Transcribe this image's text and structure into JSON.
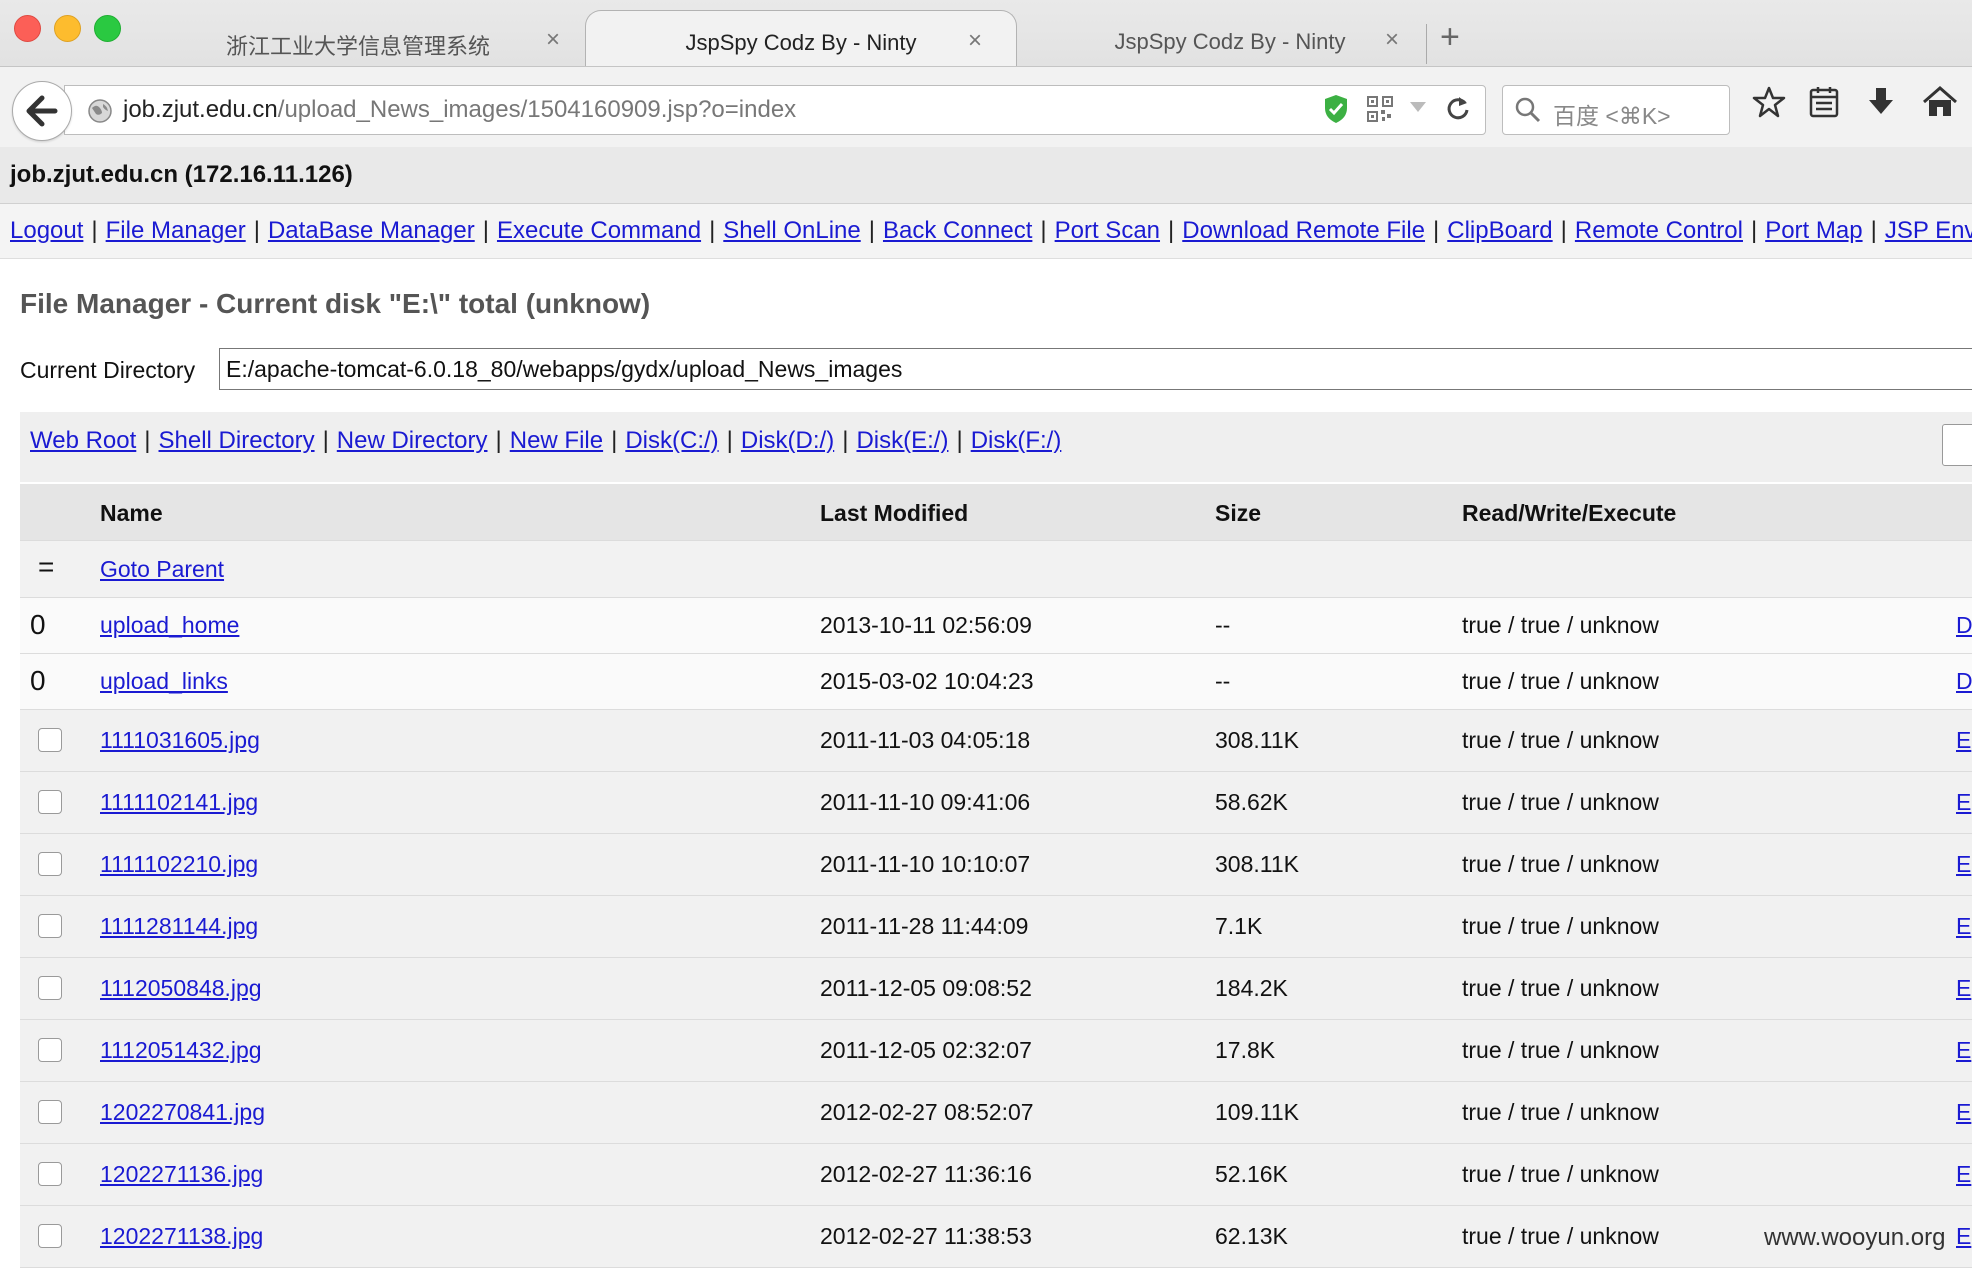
{
  "browser": {
    "tabs": [
      {
        "label": "浙江工业大学信息管理系统",
        "active": false
      },
      {
        "label": "JspSpy Codz By - Ninty",
        "active": true
      },
      {
        "label": "JspSpy Codz By - Ninty",
        "active": false
      }
    ],
    "tab_close_glyph": "×",
    "new_tab_glyph": "+",
    "url_host": "job.zjut.edu.cn",
    "url_path": "/upload_News_images/1504160909.jsp?o=index",
    "search_placeholder": "百度 <⌘K>"
  },
  "page": {
    "host_title": "job.zjut.edu.cn (172.16.11.126)",
    "menu": [
      "Logout",
      "File Manager",
      "DataBase Manager",
      "Execute Command",
      "Shell OnLine",
      "Back Connect",
      "Port Scan",
      "Download Remote File",
      "ClipBoard",
      "Remote Control",
      "Port Map",
      "JSP Env"
    ],
    "fm_title": "File Manager - Current disk \"E:\\\" total (unknow)",
    "current_dir_label": "Current Directory",
    "current_dir_value": "E:/apache-tomcat-6.0.18_80/webapps/gydx/upload_News_images",
    "quick_links": [
      "Web Root",
      "Shell Directory",
      "New Directory",
      "New File",
      "Disk(C:/)",
      "Disk(D:/)",
      "Disk(E:/)",
      "Disk(F:/)"
    ],
    "table": {
      "headers": {
        "name": "Name",
        "modified": "Last Modified",
        "size": "Size",
        "rwx": "Read/Write/Execute"
      },
      "parent": {
        "marker": "=",
        "label": "Goto Parent"
      },
      "dirs": [
        {
          "marker": "0",
          "name": "upload_home",
          "modified": "2013-10-11 02:56:09",
          "size": "--",
          "rwx": "true / true / unknow",
          "action": "D"
        },
        {
          "marker": "0",
          "name": "upload_links",
          "modified": "2015-03-02 10:04:23",
          "size": "--",
          "rwx": "true / true / unknow",
          "action": "D"
        }
      ],
      "files": [
        {
          "name": "1111031605.jpg",
          "modified": "2011-11-03 04:05:18",
          "size": "308.11K",
          "rwx": "true / true / unknow",
          "action": "E"
        },
        {
          "name": "1111102141.jpg",
          "modified": "2011-11-10 09:41:06",
          "size": "58.62K",
          "rwx": "true / true / unknow",
          "action": "E"
        },
        {
          "name": "1111102210.jpg",
          "modified": "2011-11-10 10:10:07",
          "size": "308.11K",
          "rwx": "true / true / unknow",
          "action": "E"
        },
        {
          "name": "1111281144.jpg",
          "modified": "2011-11-28 11:44:09",
          "size": "7.1K",
          "rwx": "true / true / unknow",
          "action": "E"
        },
        {
          "name": "1112050848.jpg",
          "modified": "2011-12-05 09:08:52",
          "size": "184.2K",
          "rwx": "true / true / unknow",
          "action": "E"
        },
        {
          "name": "1112051432.jpg",
          "modified": "2011-12-05 02:32:07",
          "size": "17.8K",
          "rwx": "true / true / unknow",
          "action": "E"
        },
        {
          "name": "1202270841.jpg",
          "modified": "2012-02-27 08:52:07",
          "size": "109.11K",
          "rwx": "true / true / unknow",
          "action": "E"
        },
        {
          "name": "1202271136.jpg",
          "modified": "2012-02-27 11:36:16",
          "size": "52.16K",
          "rwx": "true / true / unknow",
          "action": "E"
        },
        {
          "name": "1202271138.jpg",
          "modified": "2012-02-27 11:38:53",
          "size": "62.13K",
          "rwx": "true / true / unknow",
          "action": "E"
        }
      ]
    },
    "watermark": "www.wooyun.org"
  },
  "colors": {
    "link": "#1a1ad2",
    "header_bg": "#e5e5e5",
    "shield": "#3cb043"
  }
}
